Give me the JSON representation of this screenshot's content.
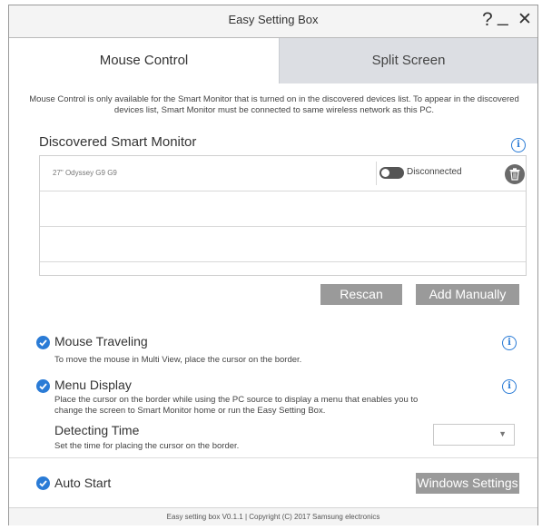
{
  "window": {
    "title": "Easy Setting Box",
    "help_label": "?",
    "minimize_label": "_",
    "close_label": "✕"
  },
  "tabs": [
    {
      "label": "Mouse Control",
      "active": true
    },
    {
      "label": "Split Screen",
      "active": false
    }
  ],
  "description": "Mouse Control is only available for the Smart Monitor that is turned on in the discovered devices list. To appear in the discovered devices list, Smart Monitor must be connected to same wireless network as this PC.",
  "discovered": {
    "title": "Discovered Smart Monitor",
    "info_icon": "info-icon",
    "devices": [
      {
        "name": "27\" Odyssey G9 G9",
        "toggle_on": false,
        "status": "Disconnected"
      }
    ]
  },
  "buttons": {
    "rescan": "Rescan",
    "add_manually": "Add Manually",
    "windows_settings": "Windows Settings"
  },
  "options": {
    "mouse_traveling": {
      "title": "Mouse Traveling",
      "desc": "To move the mouse in Multi View, place the cursor on the border.",
      "checked": true
    },
    "menu_display": {
      "title": "Menu Display",
      "desc_line1": "Place the cursor on the border while using the PC source to display a menu that enables you to",
      "desc_line2": "change the screen to Smart Monitor home or run the Easy Setting Box.",
      "checked": true
    },
    "detecting_time": {
      "title": "Detecting Time",
      "desc": "Set the time for placing the cursor on the border.",
      "selected_value": ""
    },
    "auto_start": {
      "title": "Auto Start",
      "checked": true
    }
  },
  "footer": "Easy setting box V0.1.1 | Copyright (C) 2017 Samsung electronics",
  "colors": {
    "accent": "#2a7bd6",
    "button_gray": "#9a9a9a",
    "tab_inactive": "#dcdee3"
  }
}
